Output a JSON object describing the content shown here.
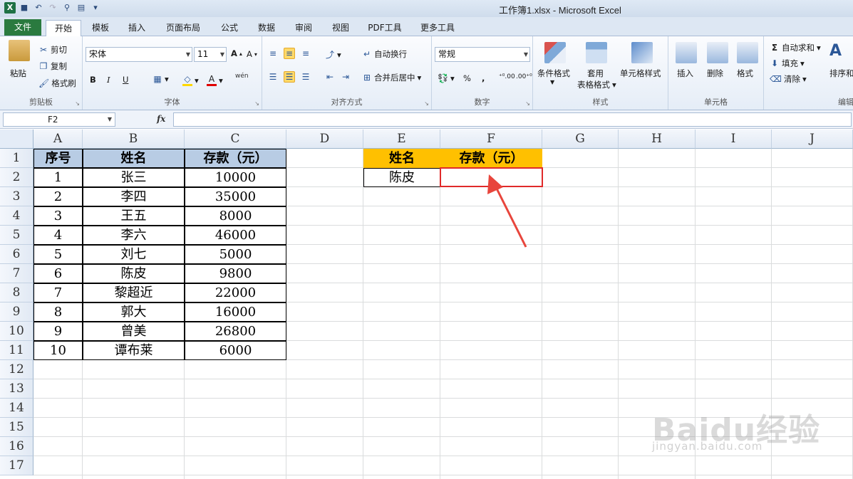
{
  "window": {
    "title": "工作簿1.xlsx - Microsoft Excel"
  },
  "tabs": [
    "文件",
    "开始",
    "模板",
    "插入",
    "页面布局",
    "公式",
    "数据",
    "审阅",
    "视图",
    "PDF工具",
    "更多工具"
  ],
  "ribbon": {
    "clipboard": {
      "label": "剪贴板",
      "paste": "粘贴",
      "cut": "剪切",
      "copy": "复制",
      "format_painter": "格式刷"
    },
    "font": {
      "label": "字体",
      "font_name": "宋体",
      "font_size": "11",
      "bold": "B",
      "italic": "I",
      "underline": "U",
      "wen": "wén"
    },
    "alignment": {
      "label": "对齐方式",
      "wrap": "自动换行",
      "merge": "合并后居中"
    },
    "number": {
      "label": "数字",
      "format": "常规",
      "percent": "%",
      "comma": ","
    },
    "styles": {
      "label": "样式",
      "conditional": "条件格式",
      "table1": "套用",
      "table2": "表格格式",
      "cell_styles": "单元格样式"
    },
    "cells": {
      "label": "单元格",
      "insert": "插入",
      "delete": "删除",
      "format": "格式"
    },
    "editing": {
      "label": "编辑",
      "autosum": "自动求和",
      "fill": "填充",
      "clear": "清除",
      "sort": "排序和"
    }
  },
  "formula_bar": {
    "name_box": "F2",
    "fx": "fx",
    "formula": ""
  },
  "columns": [
    "A",
    "B",
    "C",
    "D",
    "E",
    "F",
    "G",
    "H",
    "I",
    "J"
  ],
  "rows": [
    "1",
    "2",
    "3",
    "4",
    "5",
    "6",
    "7",
    "8",
    "9",
    "10",
    "11",
    "12",
    "13",
    "14",
    "15",
    "16",
    "17"
  ],
  "table": {
    "headers": [
      "序号",
      "姓名",
      "存款（元）"
    ],
    "rows": [
      [
        "1",
        "张三",
        "10000"
      ],
      [
        "2",
        "李四",
        "35000"
      ],
      [
        "3",
        "王五",
        "8000"
      ],
      [
        "4",
        "李六",
        "46000"
      ],
      [
        "5",
        "刘七",
        "5000"
      ],
      [
        "6",
        "陈皮",
        "9800"
      ],
      [
        "7",
        "黎超近",
        "22000"
      ],
      [
        "8",
        "郭大",
        "16000"
      ],
      [
        "9",
        "曾美",
        "26800"
      ],
      [
        "10",
        "谭布莱",
        "6000"
      ]
    ]
  },
  "lookup": {
    "headers": [
      "姓名",
      "存款（元）"
    ],
    "name": "陈皮",
    "result": ""
  },
  "colors": {
    "header_blue": "#b8cce4",
    "header_orange": "#ffc000",
    "highlight_red": "#e02a2a"
  },
  "watermark": {
    "brand": "Baidu经验",
    "url": "jingyan.baidu.com"
  }
}
